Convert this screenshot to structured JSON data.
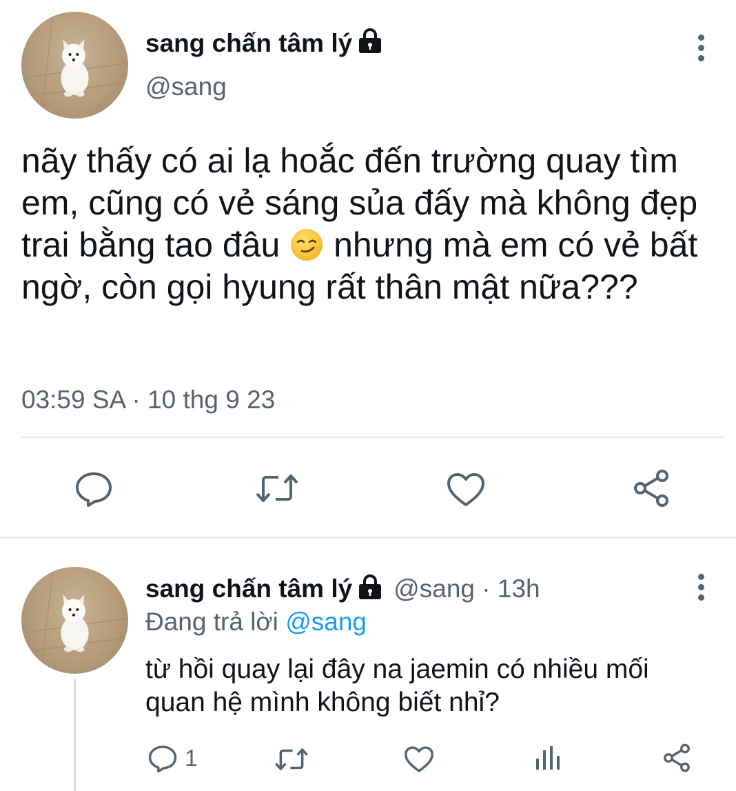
{
  "tweet": {
    "author_name": "sang chấn tâm lý",
    "author_handle": "@sang",
    "text_part1": "nãy thấy có ai lạ hoắc đến trường quay tìm em, cũng có vẻ sáng sủa đấy mà không đẹp trai bằng tao đâu ",
    "emoji": "smirking-face",
    "text_part2": " nhưng mà em có vẻ bất ngờ, còn gọi hyung rất thân mật nữa???",
    "timestamp": "03:59 SA · 10 thg 9 23",
    "actions": [
      "reply",
      "retweet",
      "like",
      "share"
    ]
  },
  "reply": {
    "author_name": "sang chấn tâm lý",
    "author_handle": "@sang",
    "time_sep": " · ",
    "time": "13h",
    "replying_label": "Đang trả lời ",
    "replying_mention": "@sang",
    "text": "từ hồi quay lại đây na jaemin có nhiều mối quan hệ mình không biết nhỉ?",
    "reply_count": "1"
  },
  "colors": {
    "text": "#0f1419",
    "secondary": "#536471",
    "accent": "#1d9bf0",
    "divider": "#e6e9eb"
  }
}
